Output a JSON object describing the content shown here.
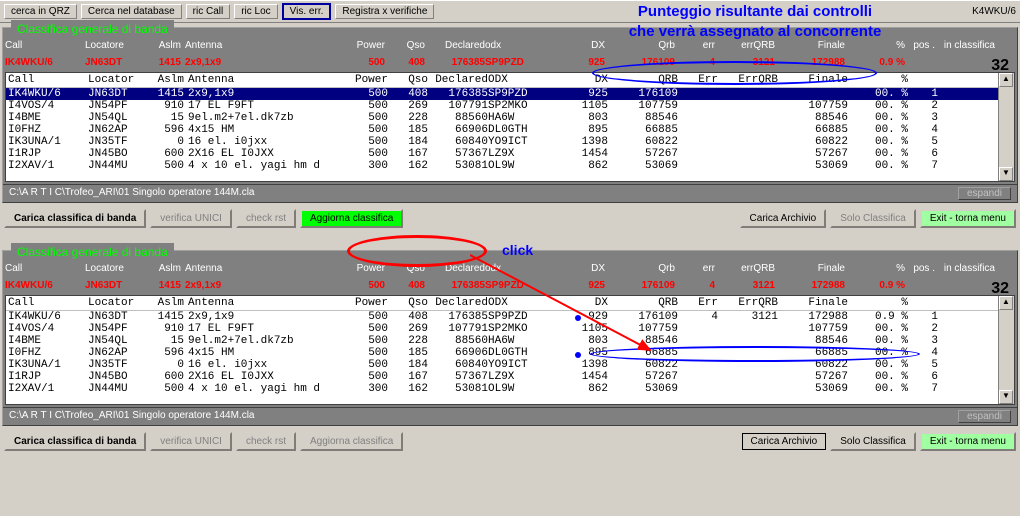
{
  "annotation": {
    "line1": "Punteggio risultante dai controlli",
    "line2": "che verrà assegnato al concorrente"
  },
  "toolbar": {
    "cerca_qrz": "cerca in QRZ",
    "cerca_db": "Cerca nel database",
    "ric_call": "ric Call",
    "ric_loc": "ric Loc",
    "vis_err": "Vis. err.",
    "registra": "Registra x verifiche",
    "right_text": "K4WKU/6"
  },
  "click_label": "click",
  "panel1": {
    "title": "Classifica generale di banda",
    "headers": [
      "Call",
      "Locatore",
      "Aslm",
      "Antenna",
      "Power",
      "Qso",
      "Declared",
      "odx",
      "DX",
      "Qrb",
      "err",
      "errQRB",
      "Finale",
      "%",
      "pos .",
      "in classifica"
    ],
    "summary": {
      "call": "IK4WKU/6",
      "loc": "JN63DT",
      "aslm": "1415",
      "ant": "2x9,1x9",
      "pwr": "500",
      "qso": "408",
      "dec": "176385",
      "odx": "SP9PZD",
      "dx": "925",
      "qrb": "176109",
      "err": "4",
      "eq": "3121",
      "fin": "172988",
      "pct": "0.9 %",
      "pos": "32"
    },
    "theaders": [
      "Call",
      "Locator",
      "Aslm",
      "Antenna",
      "Power",
      "Qso",
      "Declared",
      "ODX",
      "DX",
      "QRB",
      "Err",
      "ErrQRB",
      "Finale",
      "%",
      ""
    ],
    "rows": [
      {
        "sel": true,
        "call": "IK4WKU/6",
        "loc": "JN63DT",
        "aslm": "1415",
        "ant": "2x9,1x9",
        "pwr": "500",
        "qso": "408",
        "dec": "176385",
        "odx": "SP9PZD",
        "dx": "925",
        "qrb": "176109",
        "err": "",
        "eq": "",
        "fin": "",
        "pct": "00. %",
        "pos": "1"
      },
      {
        "sel": false,
        "call": "I4VOS/4",
        "loc": "JN54PF",
        "aslm": "910",
        "ant": "17 EL F9FT",
        "pwr": "500",
        "qso": "269",
        "dec": "107791",
        "odx": "SP2MKO",
        "dx": "1105",
        "qrb": "107759",
        "err": "",
        "eq": "",
        "fin": "107759",
        "pct": "00. %",
        "pos": "2"
      },
      {
        "sel": false,
        "call": "I4BME",
        "loc": "JN54QL",
        "aslm": "15",
        "ant": "9el.m2+7el.dk7zb",
        "pwr": "500",
        "qso": "228",
        "dec": "88560",
        "odx": "HA6W",
        "dx": "803",
        "qrb": "88546",
        "err": "",
        "eq": "",
        "fin": "88546",
        "pct": "00. %",
        "pos": "3"
      },
      {
        "sel": false,
        "call": "I0FHZ",
        "loc": "JN62AP",
        "aslm": "596",
        "ant": "4x15 HM",
        "pwr": "500",
        "qso": "185",
        "dec": "66906",
        "odx": "DL0GTH",
        "dx": "895",
        "qrb": "66885",
        "err": "",
        "eq": "",
        "fin": "66885",
        "pct": "00. %",
        "pos": "4"
      },
      {
        "sel": false,
        "call": "IK3UNA/1",
        "loc": "JN35TF",
        "aslm": "0",
        "ant": "16 el. i0jxx",
        "pwr": "500",
        "qso": "184",
        "dec": "60840",
        "odx": "YO9ICT",
        "dx": "1398",
        "qrb": "60822",
        "err": "",
        "eq": "",
        "fin": "60822",
        "pct": "00. %",
        "pos": "5"
      },
      {
        "sel": false,
        "call": "I1RJP",
        "loc": "JN45BO",
        "aslm": "600",
        "ant": "2X16 EL I0JXX",
        "pwr": "500",
        "qso": "167",
        "dec": "57367",
        "odx": "LZ9X",
        "dx": "1454",
        "qrb": "57267",
        "err": "",
        "eq": "",
        "fin": "57267",
        "pct": "00. %",
        "pos": "6"
      },
      {
        "sel": false,
        "call": "I2XAV/1",
        "loc": "JN44MU",
        "aslm": "500",
        "ant": "4 x 10 el. yagi hm d",
        "pwr": "300",
        "qso": "162",
        "dec": "53081",
        "odx": "OL9W",
        "dx": "862",
        "qrb": "53069",
        "err": "",
        "eq": "",
        "fin": "53069",
        "pct": "00. %",
        "pos": "7"
      }
    ],
    "status": "C:\\A R T I C\\Trofeo_ARI\\01 Singolo operatore 144M.cla",
    "espandi": "espandi"
  },
  "buttons1": {
    "carica": "Carica classifica di banda",
    "verifica": "verifica UNICI",
    "check": "check rst",
    "aggiorna": "Aggiorna classifica",
    "archivio": "Carica Archivio",
    "solo": "Solo Classifica",
    "exit": "Exit - torna menu"
  },
  "panel2": {
    "title": "Classifica generale di banda",
    "headers": [
      "Call",
      "Locatore",
      "Aslm",
      "Antenna",
      "Power",
      "Qso",
      "Declared",
      "odx",
      "DX",
      "Qrb",
      "err",
      "errQRB",
      "Finale",
      "%",
      "pos .",
      "in classifica"
    ],
    "summary": {
      "call": "IK4WKU/6",
      "loc": "JN63DT",
      "aslm": "1415",
      "ant": "2x9,1x9",
      "pwr": "500",
      "qso": "408",
      "dec": "176385",
      "odx": "SP9PZD",
      "dx": "925",
      "qrb": "176109",
      "err": "4",
      "eq": "3121",
      "fin": "172988",
      "pct": "0.9 %",
      "pos": "32"
    },
    "theaders": [
      "Call",
      "Locator",
      "Aslm",
      "Antenna",
      "Power",
      "Qso",
      "Declared",
      "ODX",
      "DX",
      "QRB",
      "Err",
      "ErrQRB",
      "Finale",
      "%",
      ""
    ],
    "rows": [
      {
        "sel": false,
        "call": "IK4WKU/6",
        "loc": "JN63DT",
        "aslm": "1415",
        "ant": "2x9,1x9",
        "pwr": "500",
        "qso": "408",
        "dec": "176385",
        "odx": "SP9PZD",
        "dx": "929",
        "qrb": "176109",
        "err": "4",
        "eq": "3121",
        "fin": "172988",
        "pct": "0.9 %",
        "pos": "1"
      },
      {
        "sel": false,
        "call": "I4VOS/4",
        "loc": "JN54PF",
        "aslm": "910",
        "ant": "17 EL F9FT",
        "pwr": "500",
        "qso": "269",
        "dec": "107791",
        "odx": "SP2MKO",
        "dx": "1105",
        "qrb": "107759",
        "err": "",
        "eq": "",
        "fin": "107759",
        "pct": "00. %",
        "pos": "2"
      },
      {
        "sel": false,
        "call": "I4BME",
        "loc": "JN54QL",
        "aslm": "15",
        "ant": "9el.m2+7el.dk7zb",
        "pwr": "500",
        "qso": "228",
        "dec": "88560",
        "odx": "HA6W",
        "dx": "803",
        "qrb": "88546",
        "err": "",
        "eq": "",
        "fin": "88546",
        "pct": "00. %",
        "pos": "3"
      },
      {
        "sel": false,
        "call": "I0FHZ",
        "loc": "JN62AP",
        "aslm": "596",
        "ant": "4x15 HM",
        "pwr": "500",
        "qso": "185",
        "dec": "66906",
        "odx": "DL0GTH",
        "dx": "895",
        "qrb": "66885",
        "err": "",
        "eq": "",
        "fin": "66885",
        "pct": "00. %",
        "pos": "4"
      },
      {
        "sel": false,
        "call": "IK3UNA/1",
        "loc": "JN35TF",
        "aslm": "0",
        "ant": "16 el. i0jxx",
        "pwr": "500",
        "qso": "184",
        "dec": "60840",
        "odx": "YO9ICT",
        "dx": "1398",
        "qrb": "60822",
        "err": "",
        "eq": "",
        "fin": "60822",
        "pct": "00. %",
        "pos": "5"
      },
      {
        "sel": false,
        "call": "I1RJP",
        "loc": "JN45BO",
        "aslm": "600",
        "ant": "2X16 EL I0JXX",
        "pwr": "500",
        "qso": "167",
        "dec": "57367",
        "odx": "LZ9X",
        "dx": "1454",
        "qrb": "57267",
        "err": "",
        "eq": "",
        "fin": "57267",
        "pct": "00. %",
        "pos": "6"
      },
      {
        "sel": false,
        "call": "I2XAV/1",
        "loc": "JN44MU",
        "aslm": "500",
        "ant": "4 x 10 el. yagi hm d",
        "pwr": "300",
        "qso": "162",
        "dec": "53081",
        "odx": "OL9W",
        "dx": "862",
        "qrb": "53069",
        "err": "",
        "eq": "",
        "fin": "53069",
        "pct": "00. %",
        "pos": "7"
      }
    ],
    "status": "C:\\A R T I C\\Trofeo_ARI\\01 Singolo operatore 144M.cla",
    "espandi": "espandi"
  },
  "buttons2": {
    "carica": "Carica classifica di banda",
    "verifica": "verifica UNICI",
    "check": "check rst",
    "aggiorna": "Aggiorna classifica",
    "archivio": "Carica Archivio",
    "solo": "Solo Classifica",
    "exit": "Exit - torna menu"
  }
}
